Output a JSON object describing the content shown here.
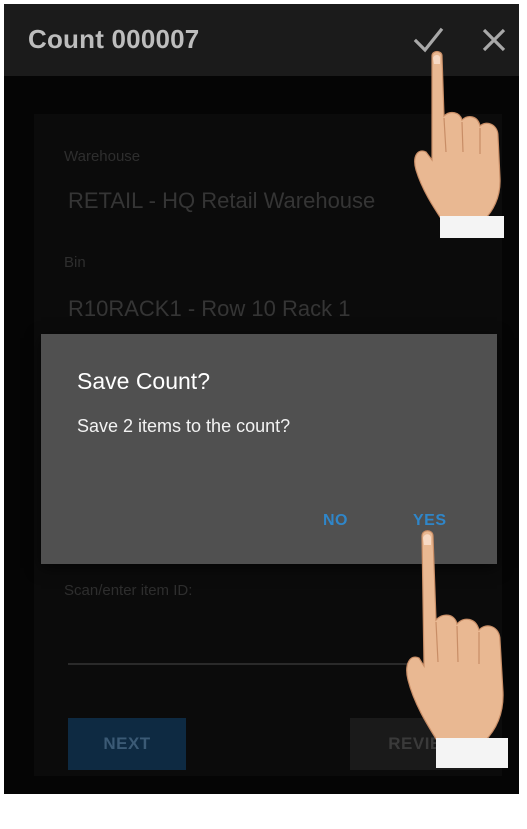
{
  "app_bar": {
    "title": "Count 000007",
    "confirm_icon": "checkmark-icon",
    "close_icon": "close-icon"
  },
  "form": {
    "warehouse_label": "Warehouse",
    "warehouse_value": "RETAIL - HQ Retail Warehouse",
    "bin_label": "Bin",
    "bin_value": "R10RACK1 - Row 10 Rack 1",
    "item_label": "Scan/enter item ID:",
    "item_value": "",
    "next_label": "NEXT",
    "review_label": "REVIE"
  },
  "dialog": {
    "title": "Save Count?",
    "message": "Save 2 items to the count?",
    "no_label": "NO",
    "yes_label": "YES"
  },
  "colors": {
    "accent": "#2f86c9",
    "dialog_bg": "#505050",
    "app_bar_bg": "#1b1b1b"
  },
  "overlays": {
    "hand_top": "pointing-hand-icon",
    "hand_bottom": "pointing-hand-icon"
  }
}
